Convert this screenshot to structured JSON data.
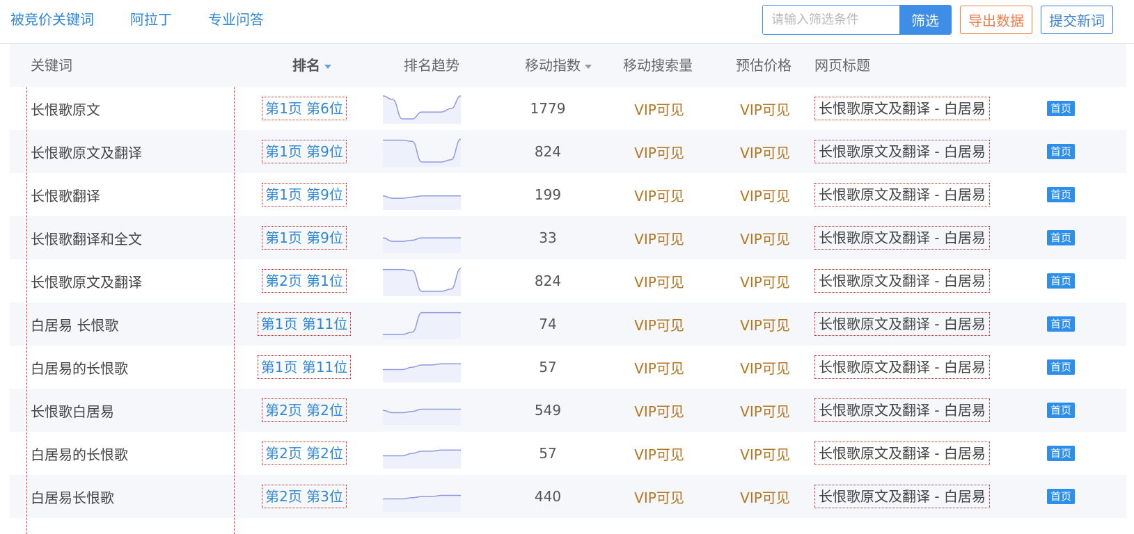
{
  "tabs": [
    "被竞价关键词",
    "阿拉丁",
    "专业问答"
  ],
  "toolbar": {
    "filter_placeholder": "请输入筛选条件",
    "filter_button": "筛选",
    "export_button": "导出数据",
    "submit_button": "提交新词"
  },
  "columns": {
    "keyword": "关键词",
    "rank": "排名",
    "trend": "排名趋势",
    "mobile_index": "移动指数",
    "mobile_volume": "移动搜索量",
    "price": "预估价格",
    "page_title": "网页标题"
  },
  "colors": {
    "accent": "#3e8de6",
    "export": "#f07a45",
    "vip": "#b3761e",
    "trend_line": "#8f9ae0",
    "trend_fill": "#eef1fb",
    "dotted_marker": "#e02020"
  },
  "rows": [
    {
      "keyword": "长恨歌原文",
      "rank": "第1页 第6位",
      "index": "1779",
      "volume": "VIP可见",
      "price": "VIP可见",
      "title": "长恨歌原文及翻译 - 白居易",
      "link": "首页",
      "trend": [
        1,
        0.85,
        0,
        0,
        0.3,
        0.3,
        0.3,
        0.45,
        1
      ]
    },
    {
      "keyword": "长恨歌原文及翻译",
      "rank": "第1页 第9位",
      "index": "824",
      "volume": "VIP可见",
      "price": "VIP可见",
      "title": "长恨歌原文及翻译 - 白居易",
      "link": "首页",
      "trend": [
        0.95,
        0.95,
        0.95,
        0.9,
        0,
        0,
        0,
        0.1,
        1
      ]
    },
    {
      "keyword": "长恨歌翻译",
      "rank": "第1页 第9位",
      "index": "199",
      "volume": "VIP可见",
      "price": "VIP可见",
      "title": "长恨歌原文及翻译 - 白居易",
      "link": "首页",
      "trend": [
        0.4,
        0.3,
        0.3,
        0.35,
        0.4,
        0.4,
        0.4,
        0.4,
        0.4
      ]
    },
    {
      "keyword": "长恨歌翻译和全文",
      "rank": "第1页 第9位",
      "index": "33",
      "volume": "VIP可见",
      "price": "VIP可见",
      "title": "长恨歌原文及翻译 - 白居易",
      "link": "首页",
      "trend": [
        0.45,
        0.3,
        0.3,
        0.35,
        0.45,
        0.45,
        0.45,
        0.45,
        0.45
      ]
    },
    {
      "keyword": "长恨歌原文及翻译",
      "rank": "第2页 第1位",
      "index": "824",
      "volume": "VIP可见",
      "price": "VIP可见",
      "title": "长恨歌原文及翻译 - 白居易",
      "link": "首页",
      "trend": [
        0.95,
        0.95,
        0.95,
        0.9,
        0,
        0,
        0,
        0.1,
        1
      ]
    },
    {
      "keyword": "白居易 长恨歌",
      "rank": "第1页 第11位",
      "index": "74",
      "volume": "VIP可见",
      "price": "VIP可见",
      "title": "长恨歌原文及翻译 - 白居易",
      "link": "首页",
      "trend": [
        0,
        0,
        0,
        0.1,
        0.95,
        0.95,
        0.95,
        0.95,
        0.95
      ]
    },
    {
      "keyword": "白居易的长恨歌",
      "rank": "第1页 第11位",
      "index": "57",
      "volume": "VIP可见",
      "price": "VIP可见",
      "title": "长恨歌原文及翻译 - 白居易",
      "link": "首页",
      "trend": [
        0.35,
        0.35,
        0.35,
        0.45,
        0.55,
        0.55,
        0.6,
        0.6,
        0.6
      ]
    },
    {
      "keyword": "长恨歌白居易",
      "rank": "第2页 第2位",
      "index": "549",
      "volume": "VIP可见",
      "price": "VIP可见",
      "title": "长恨歌原文及翻译 - 白居易",
      "link": "首页",
      "trend": [
        0.45,
        0.35,
        0.35,
        0.4,
        0.5,
        0.5,
        0.5,
        0.5,
        0.5
      ]
    },
    {
      "keyword": "白居易的长恨歌",
      "rank": "第2页 第2位",
      "index": "57",
      "volume": "VIP可见",
      "price": "VIP可见",
      "title": "长恨歌原文及翻译 - 白居易",
      "link": "首页",
      "trend": [
        0.35,
        0.35,
        0.35,
        0.45,
        0.55,
        0.55,
        0.6,
        0.6,
        0.6
      ]
    },
    {
      "keyword": "白居易长恨歌",
      "rank": "第2页 第3位",
      "index": "440",
      "volume": "VIP可见",
      "price": "VIP可见",
      "title": "长恨歌原文及翻译 - 白居易",
      "link": "首页",
      "trend": [
        0.35,
        0.35,
        0.35,
        0.4,
        0.45,
        0.45,
        0.5,
        0.5,
        0.5
      ]
    }
  ]
}
